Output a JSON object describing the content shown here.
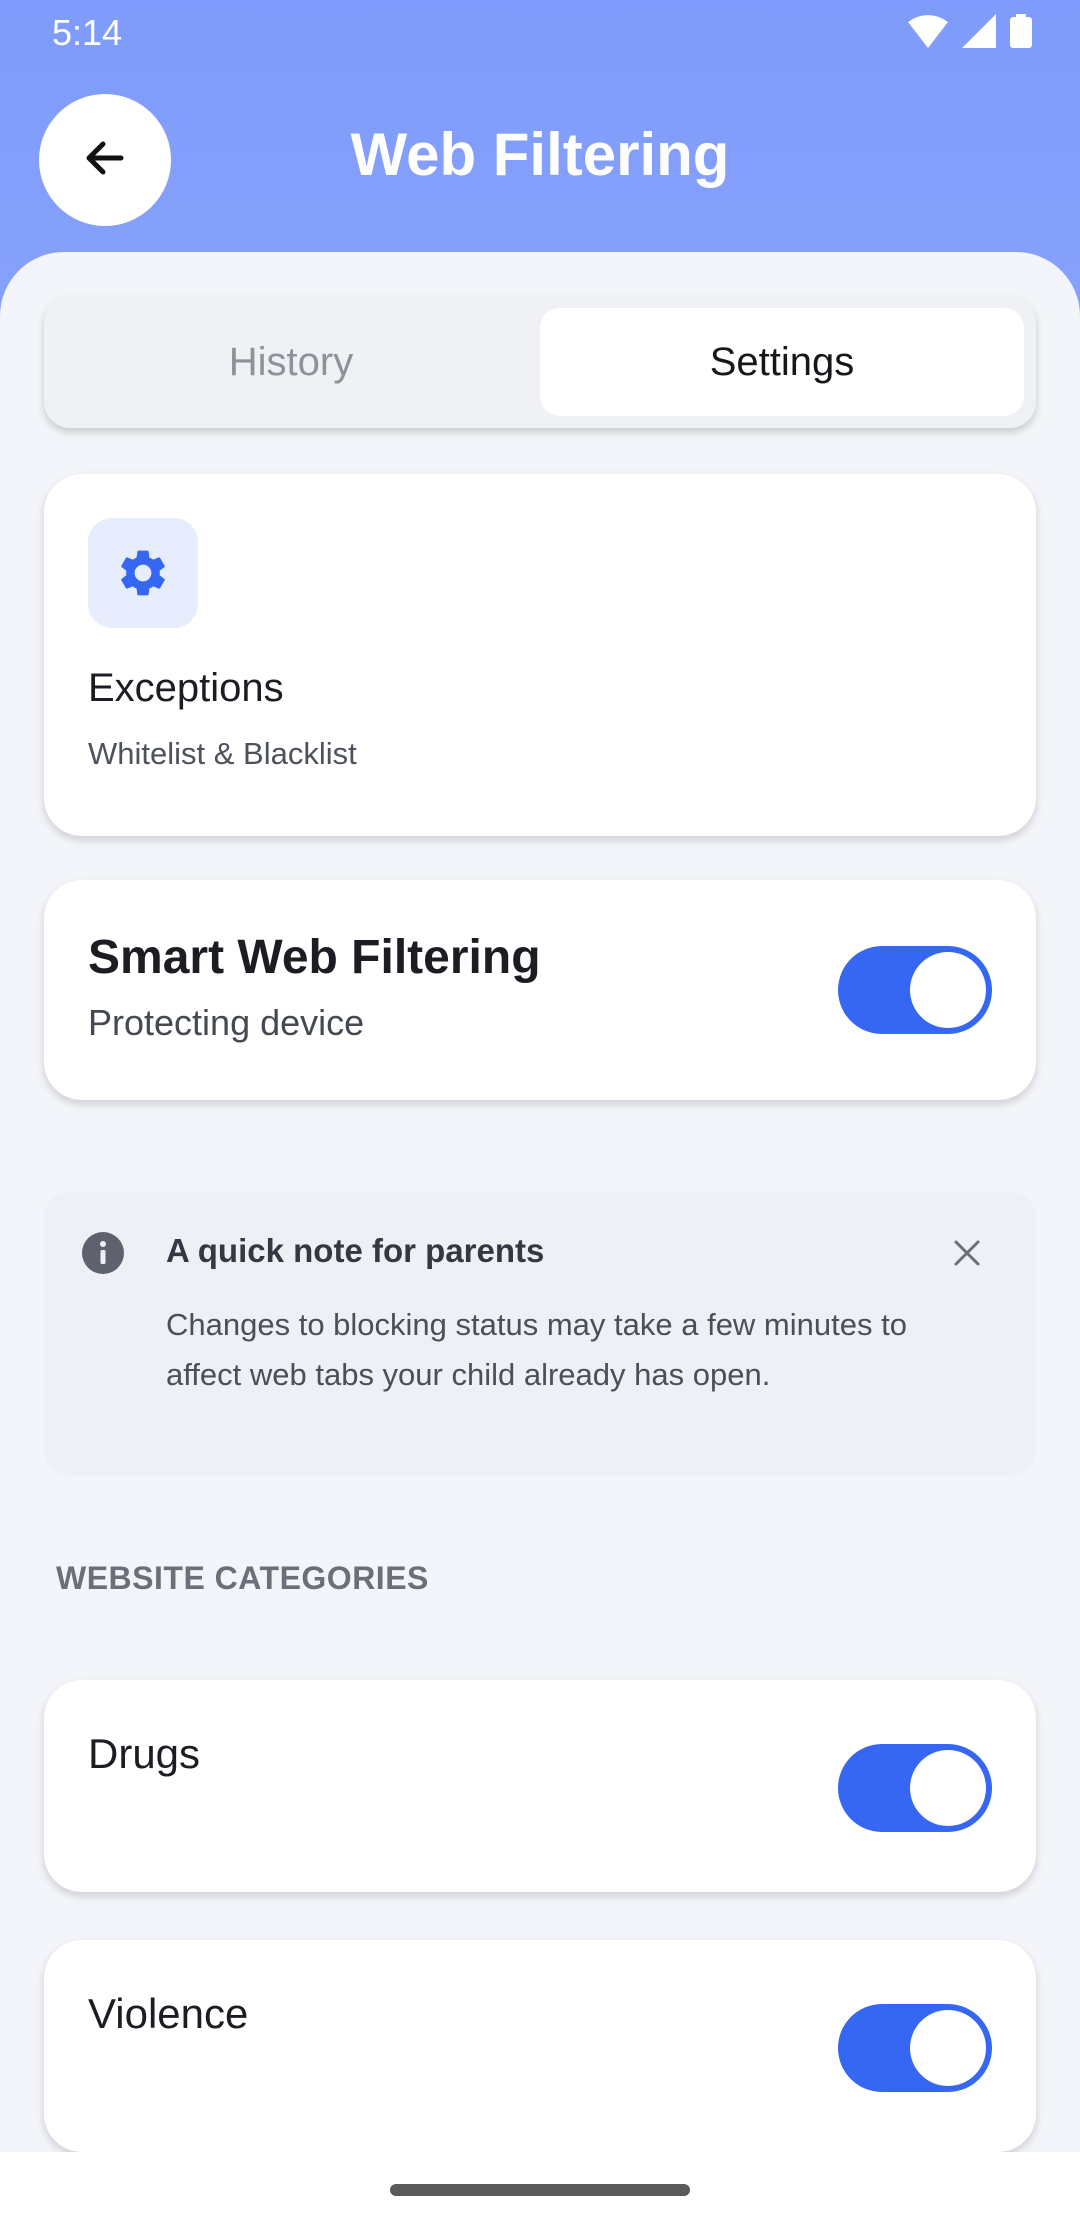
{
  "status": {
    "time": "5:14"
  },
  "header": {
    "title": "Web Filtering"
  },
  "tabs": [
    {
      "label": "History",
      "selected": false
    },
    {
      "label": "Settings",
      "selected": true
    }
  ],
  "exceptions": {
    "title": "Exceptions",
    "subtitle": "Whitelist & Blacklist",
    "icon": "gear-icon"
  },
  "smart_filtering": {
    "title": "Smart Web Filtering",
    "subtitle": "Protecting device",
    "enabled": true
  },
  "note": {
    "title": "A quick note for parents",
    "text": "Changes to blocking status may take a few minutes to affect web tabs your child already has open."
  },
  "section": {
    "label": "WEBSITE CATEGORIES"
  },
  "categories": [
    {
      "label": "Drugs",
      "enabled": true
    },
    {
      "label": "Violence",
      "enabled": true
    }
  ],
  "colors": {
    "header": "#7f9bfb",
    "accent": "#3667f3",
    "background": "#f3f5fa"
  }
}
